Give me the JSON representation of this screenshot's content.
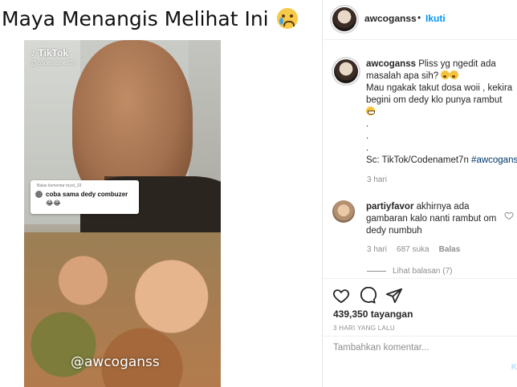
{
  "headline": {
    "text": "Maya Menangis Melihat Ini"
  },
  "media": {
    "platform_label": "TikTok",
    "platform_handle": "@codenamet7n",
    "reply_bubble": {
      "reply_to": "Balas komentar toyot_33",
      "text": "coba sama dedy combuzer😂😂"
    },
    "watermark": "@awcoganss"
  },
  "post": {
    "header": {
      "username": "awcoganss",
      "separator": "•",
      "follow_label": "Ikuti"
    },
    "caption": {
      "username": "awcoganss",
      "line1": "Pliss yg ngedit ada",
      "line2": "masalah apa sih?",
      "line3": "Mau ngakak takut dosa woii , kekira",
      "line4": "begini om dedy klo punya rambut",
      "dots": [
        ".",
        ".",
        "."
      ],
      "source_prefix": "Sc: TikTok/Codenamet7n",
      "hashtag": "#awcoganss",
      "time": "3 hari"
    },
    "comments": [
      {
        "username": "partiyfavor",
        "text_line1": "akhirnya ada",
        "text_line2": "gambaran kalo nanti rambut om",
        "text_line3": "dedy numbuh",
        "time": "3 hari",
        "likes": "687 suka",
        "reply_label": "Balas",
        "view_replies": "Lihat balasan (7)"
      }
    ],
    "views": "439,350 tayangan",
    "date": "3 HARI YANG LALU",
    "add_comment_placeholder": "Tambahkan komentar...",
    "post_button": "K"
  },
  "colors": {
    "follow_blue": "#0095f6",
    "hashtag_navy": "#00376b",
    "muted_gray": "#8e8e8e"
  }
}
